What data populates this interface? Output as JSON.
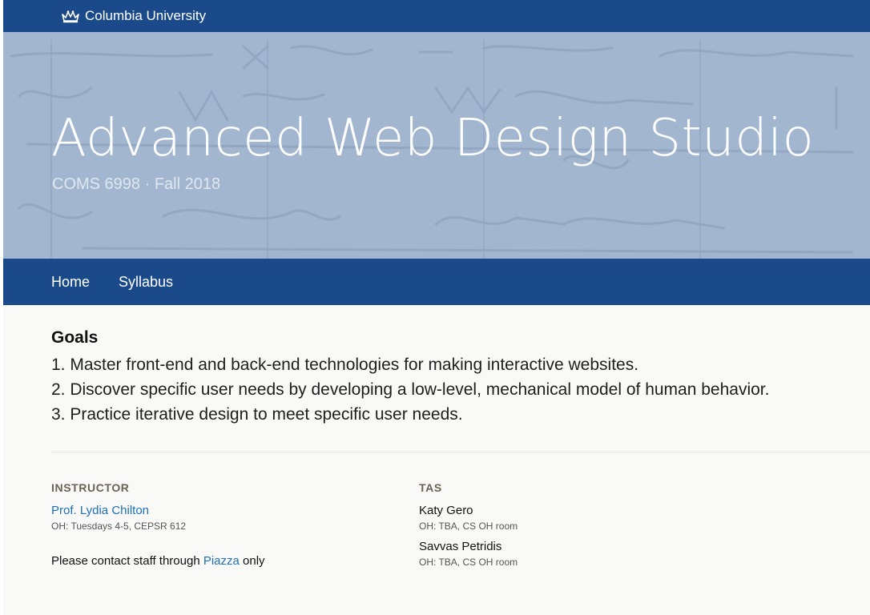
{
  "header": {
    "university": "Columbia University",
    "logo_icon": "crown-icon",
    "bar_color": "#1b4a8a"
  },
  "hero": {
    "title": "Advanced Web Design Studio",
    "subtitle": "COMS 6998 · Fall 2018",
    "background_color": "#a3b6cf"
  },
  "nav": {
    "items": [
      {
        "label": "Home"
      },
      {
        "label": "Syllabus"
      }
    ]
  },
  "goals": {
    "heading": "Goals",
    "items": [
      "1. Master front-end and back-end technologies for making interactive websites.",
      "2. Discover specific user needs by developing a low-level, mechanical model of human behavior.",
      "3. Practice iterative design to meet specific user needs."
    ]
  },
  "instructor": {
    "heading": "INSTRUCTOR",
    "name": "Prof. Lydia Chilton",
    "office_hours": "OH: Tuesdays 4-5, CEPSR 612",
    "contact_prefix": "Please contact staff through ",
    "contact_link": "Piazza",
    "contact_suffix": " only"
  },
  "tas": {
    "heading": "TAS",
    "people": [
      {
        "name": "Katy Gero",
        "office_hours": "OH: TBA, CS OH room"
      },
      {
        "name": "Savvas Petridis",
        "office_hours": "OH: TBA, CS OH room"
      }
    ]
  },
  "colors": {
    "link": "#1f6fb5",
    "page_background": "#f9f9f8"
  }
}
